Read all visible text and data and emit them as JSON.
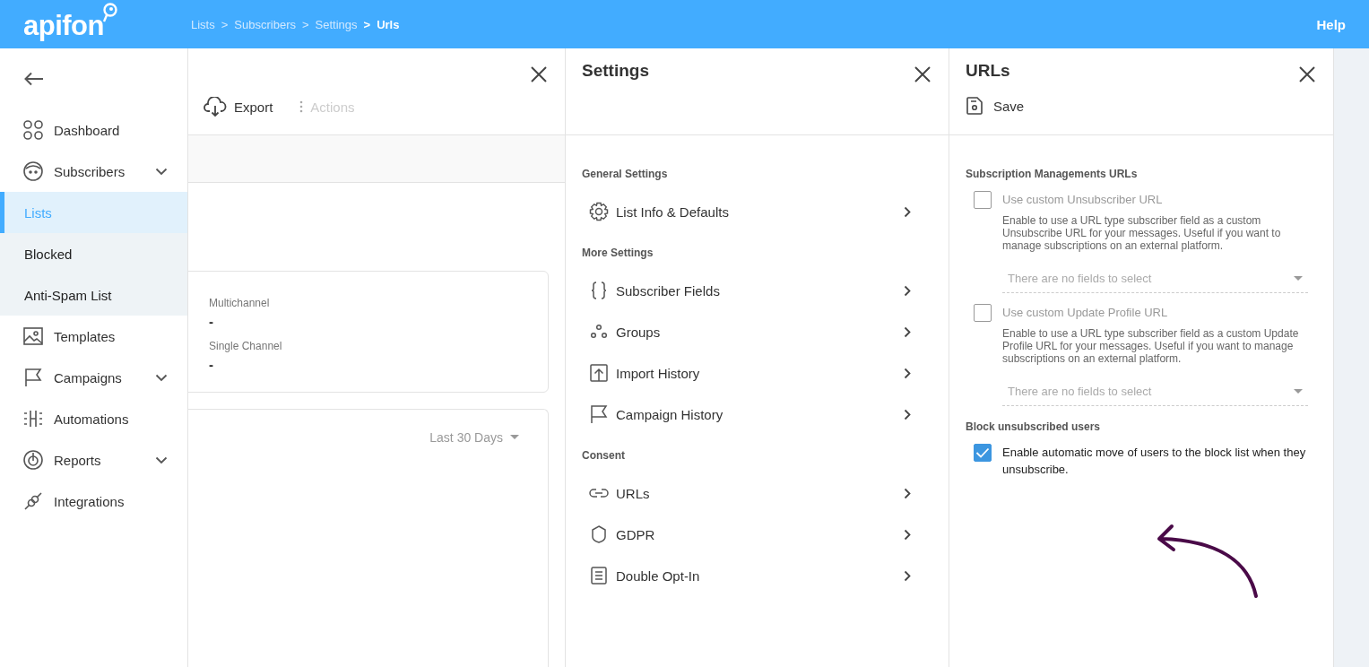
{
  "header": {
    "logo": "apifon",
    "breadcrumbs": [
      {
        "label": "Lists",
        "current": false
      },
      {
        "label": ">",
        "current": false
      },
      {
        "label": "Subscribers",
        "current": false
      },
      {
        "label": ">",
        "current": false
      },
      {
        "label": "Settings",
        "current": false
      },
      {
        "label": ">",
        "current": true
      },
      {
        "label": "Urls",
        "current": true
      }
    ],
    "help": "Help"
  },
  "sidebar": {
    "items": [
      {
        "label": "Dashboard",
        "kind": "link",
        "selected": false
      },
      {
        "label": "Subscribers",
        "kind": "group",
        "selected": false,
        "children": [
          {
            "label": "Lists",
            "selected": true
          },
          {
            "label": "Blocked",
            "selected": false
          },
          {
            "label": "Anti-Spam List",
            "selected": false
          }
        ]
      },
      {
        "label": "Templates",
        "kind": "link",
        "selected": false
      },
      {
        "label": "Campaigns",
        "kind": "group",
        "selected": false
      },
      {
        "label": "Automations",
        "kind": "link",
        "selected": false
      },
      {
        "label": "Reports",
        "kind": "group",
        "selected": false
      },
      {
        "label": "Integrations",
        "kind": "link",
        "selected": false
      }
    ]
  },
  "list_panel": {
    "toolbar": [
      {
        "label": "Export",
        "disabled": false
      },
      {
        "label": "Actions",
        "disabled": true
      }
    ],
    "stats": [
      {
        "label": "Multichannel",
        "value": "-"
      },
      {
        "label": "Single Channel",
        "value": "-"
      }
    ],
    "period": "Last 30 Days"
  },
  "settings_panel": {
    "title": "Settings",
    "sections": [
      {
        "heading": "General Settings",
        "items": [
          "List Info & Defaults"
        ]
      },
      {
        "heading": "More Settings",
        "items": [
          "Subscriber Fields",
          "Groups",
          "Import History",
          "Campaign History"
        ]
      },
      {
        "heading": "Consent",
        "items": [
          "URLs",
          "GDPR",
          "Double Opt-In"
        ]
      }
    ]
  },
  "urls_panel": {
    "title": "URLs",
    "save": "Save",
    "sections": [
      {
        "heading": "Subscription Managements URLs",
        "options": [
          {
            "label": "Use custom Unsubscriber URL",
            "checked": false,
            "description": "Enable to use a URL type subscriber field as a custom Unsubscribe URL for your messages. Useful if you want to manage subscriptions on an external platform.",
            "placeholder": "There are no fields to select"
          },
          {
            "label": "Use custom Update Profile URL",
            "checked": false,
            "description": "Enable to use a URL type subscriber field as a custom Update Profile URL for your messages. Useful if you want to manage subscriptions on an external platform.",
            "placeholder": "There are no fields to select"
          }
        ]
      },
      {
        "heading": "Block unsubscribed users",
        "options": [
          {
            "label": "Enable automatic move of users to the block list when they unsubscribe.",
            "checked": true
          }
        ]
      }
    ]
  }
}
